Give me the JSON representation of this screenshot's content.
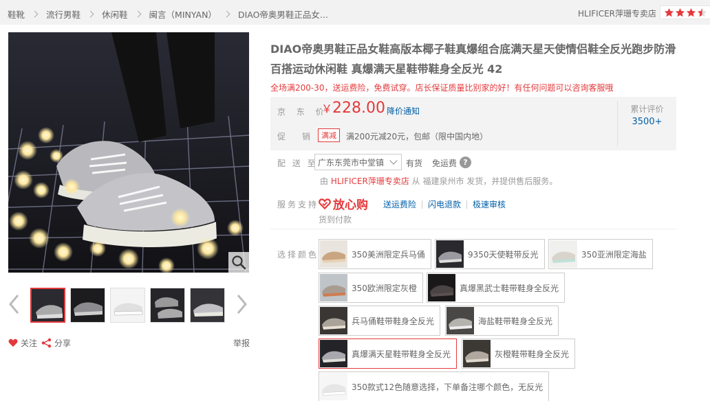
{
  "breadcrumb": {
    "items": [
      "鞋靴",
      "流行男鞋",
      "休闲鞋",
      "闽言（MINYAN）",
      "DIAO帝奥男鞋正品女..."
    ]
  },
  "shop": {
    "name": "HLIFICER萍珊专卖店",
    "rating_stars": 3.5
  },
  "gallery": {
    "zoom_icon": "search-icon",
    "prev_icon": "chevron-left-icon",
    "next_icon": "chevron-right-icon",
    "thumb_count": 5,
    "active_thumb": 1
  },
  "actions": {
    "follow": "关注",
    "share": "分享",
    "report": "举报"
  },
  "product": {
    "title": "DIAO帝奥男鞋正品女鞋高版本椰子鞋真爆组合底满天星天使情侣鞋全反光跑步防滑百搭运动休闲鞋 真爆满天星鞋带鞋身全反光 42",
    "promo_line": "全场满200-30，送运费险，免费试穿。店长保证质量比别家的好！有任何问题可以咨询客服哦"
  },
  "summary": {
    "price_label": "京 东 价",
    "currency": "￥",
    "price": "228.00",
    "notify": "降价通知",
    "promo_label": "促　销",
    "promo_tag": "满减",
    "promo_text": "满200元减20元，包邮（限中国内地）",
    "review_label": "累计评价",
    "review_count": "3500+"
  },
  "delivery": {
    "label": "配 送 至",
    "address": "广东东莞市中堂镇",
    "stock": "有货",
    "freight": "免运费",
    "help_icon": "?",
    "ship_prefix": "由",
    "ship_store": "HLIFICER萍珊专卖店",
    "ship_suffix": "从 福建泉州市 发货，并提供售后服务。"
  },
  "service": {
    "label": "服务支持",
    "brand": "放心购",
    "links": [
      "送运费险",
      "闪电退款",
      "极速审核"
    ],
    "cod": "货到付款"
  },
  "colors": {
    "label": "选择颜色",
    "options": [
      {
        "name": "350美洲限定兵马俑",
        "swatch": "#c9b7a0"
      },
      {
        "name": "9350天使鞋带反光",
        "swatch": "#3a3a3c"
      },
      {
        "name": "350亚洲限定海盐",
        "swatch": "#dcd9d2"
      },
      {
        "name": "350欧洲限定灰橙",
        "swatch": "#b8a898"
      },
      {
        "name": "真爆黑武士鞋带鞋身全反光",
        "swatch": "#2a2424"
      },
      {
        "name": "兵马俑鞋带鞋身全反光",
        "swatch": "#4a4540"
      },
      {
        "name": "海盐鞋带鞋身全反光",
        "swatch": "#5a5855"
      },
      {
        "name": "真爆满天星鞋带鞋身全反光",
        "swatch": "#2e2e33"
      },
      {
        "name": "灰橙鞋带鞋身全反光",
        "swatch": "#4d4844"
      },
      {
        "name": "350款式12色随意选择，下单备注哪个颜色，无反光",
        "swatch": "#f3f3f3"
      }
    ],
    "selected_index": 7
  },
  "colors_theme": {
    "accent": "#e4393c",
    "link": "#005ea7"
  }
}
